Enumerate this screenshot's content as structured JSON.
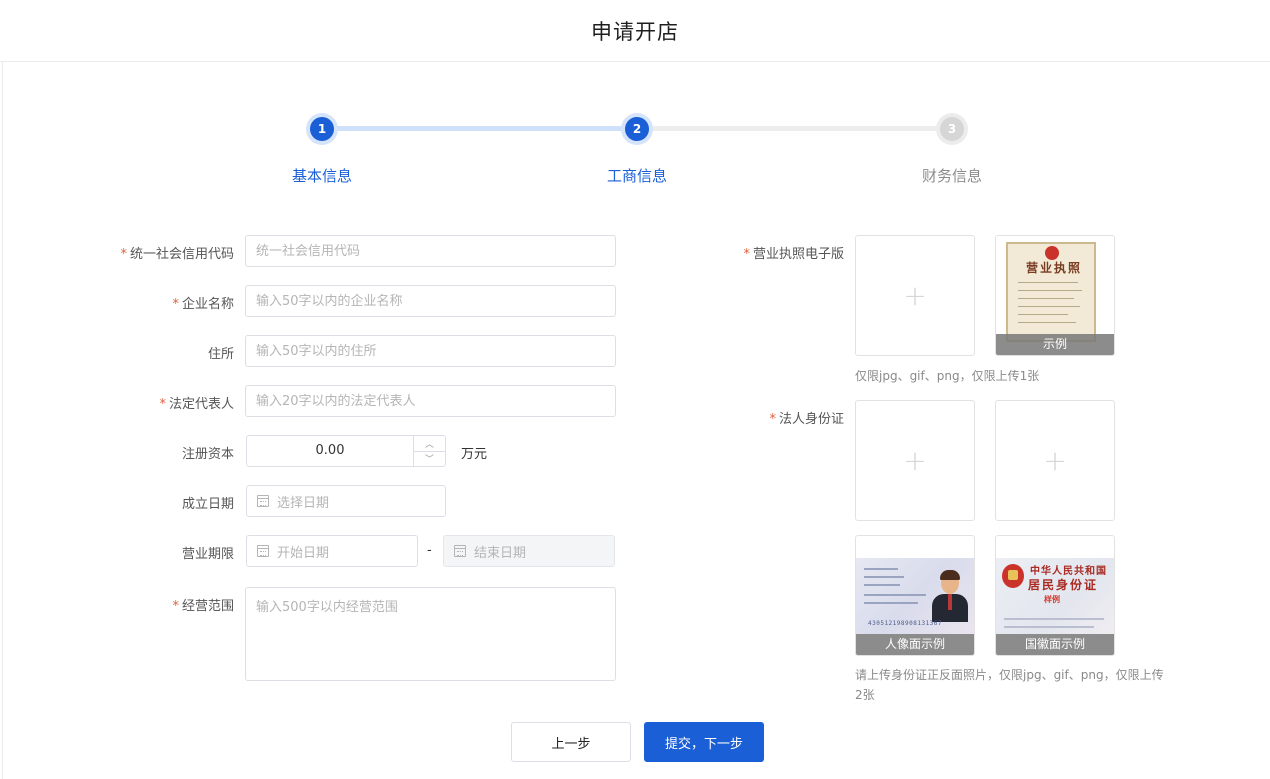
{
  "header": {
    "title": "申请开店"
  },
  "steps": [
    {
      "num": "1",
      "label": "基本信息",
      "state": "done"
    },
    {
      "num": "2",
      "label": "工商信息",
      "state": "done"
    },
    {
      "num": "3",
      "label": "财务信息",
      "state": "todo"
    }
  ],
  "form": {
    "credit_code": {
      "label": "统一社会信用代码",
      "required": true,
      "placeholder": "统一社会信用代码",
      "value": ""
    },
    "company_name": {
      "label": "企业名称",
      "required": true,
      "placeholder": "输入50字以内的企业名称",
      "value": ""
    },
    "address": {
      "label": "住所",
      "required": false,
      "placeholder": "输入50字以内的住所",
      "value": ""
    },
    "legal_rep": {
      "label": "法定代表人",
      "required": true,
      "placeholder": "输入20字以内的法定代表人",
      "value": ""
    },
    "capital": {
      "label": "注册资本",
      "value": "0.00",
      "unit": "万元"
    },
    "found_date": {
      "label": "成立日期",
      "placeholder": "选择日期"
    },
    "business_term": {
      "label": "营业期限",
      "start_placeholder": "开始日期",
      "end_placeholder": "结束日期",
      "separator": "-"
    },
    "scope": {
      "label": "经营范围",
      "required": true,
      "placeholder": "输入500字以内经营范围"
    }
  },
  "uploads": {
    "license": {
      "label": "营业执照电子版",
      "required": true,
      "sample_caption": "示例",
      "sample_title": "营业执照",
      "hint": "仅限jpg、gif、png，仅限上传1张"
    },
    "id_card": {
      "label": "法人身份证",
      "required": true,
      "front_caption": "人像面示例",
      "back_caption": "国徽面示例",
      "back_title_1": "中华人民共和国",
      "back_title_2": "居民身份证",
      "back_sample": "样例",
      "id_number": "430512198908131367",
      "hint_line1": "请上传身份证正反面照片，仅限jpg、gif、png，仅限上传",
      "hint_line2": "2张"
    }
  },
  "buttons": {
    "prev": "上一步",
    "next": "提交，下一步"
  },
  "icons": {
    "required_mark": "*",
    "plus": "+",
    "spin_up": "︿",
    "spin_down": "﹀"
  },
  "colors": {
    "primary": "#1a5fd6",
    "required": "#e0603a",
    "step_done_track": "#cfe0fb",
    "step_todo_track": "#ededed"
  }
}
